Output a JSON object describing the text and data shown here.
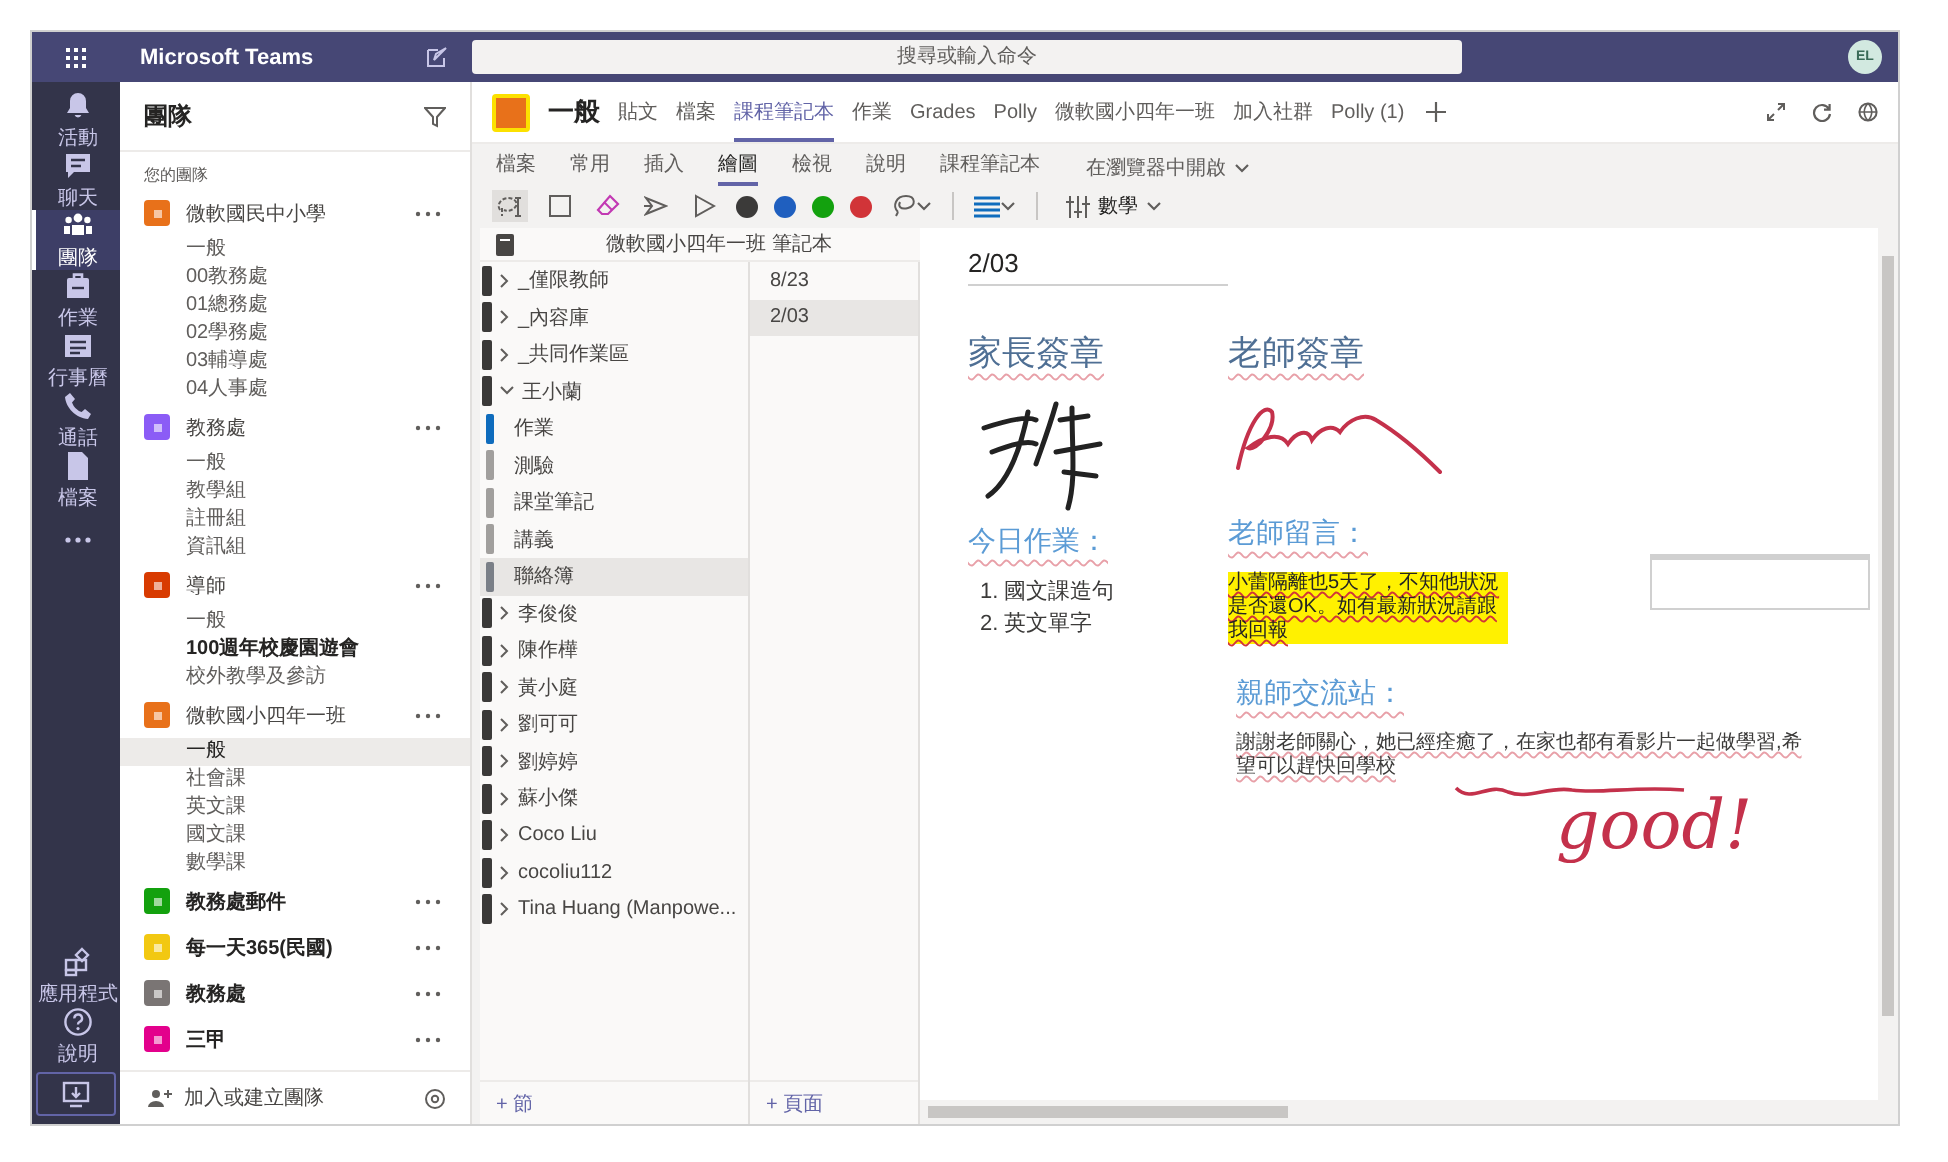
{
  "app": {
    "title": "Microsoft Teams",
    "search": {
      "placeholder": "搜尋或輸入命令"
    },
    "avatar": "EL"
  },
  "rail": [
    {
      "kind": "activity",
      "label": "活動",
      "selected": false
    },
    {
      "kind": "chat",
      "label": "聊天",
      "selected": false
    },
    {
      "kind": "teams",
      "label": "團隊",
      "selected": true
    },
    {
      "kind": "assignments",
      "label": "作業",
      "selected": false
    },
    {
      "kind": "calendar",
      "label": "行事曆",
      "selected": false
    },
    {
      "kind": "calls",
      "label": "通話",
      "selected": false
    },
    {
      "kind": "files",
      "label": "檔案",
      "selected": false
    },
    {
      "kind": "more",
      "selected": false
    }
  ],
  "rail_bottom": [
    {
      "kind": "apps",
      "label": "應用程式"
    },
    {
      "kind": "help",
      "label": "說明"
    },
    {
      "kind": "download"
    }
  ],
  "teams_panel": {
    "title": "團隊",
    "section_label": "您的團隊",
    "join": "加入或建立團隊",
    "teams": [
      {
        "name": "微軟國民中小學",
        "color": "#e8711a",
        "bold": false,
        "channels": [
          {
            "name": "一般",
            "selected": false,
            "bold": false
          },
          {
            "name": "00教務處",
            "selected": false,
            "bold": false
          },
          {
            "name": "01總務處",
            "selected": false,
            "bold": false
          },
          {
            "name": "02學務處",
            "selected": false,
            "bold": false
          },
          {
            "name": "03輔導處",
            "selected": false,
            "bold": false
          },
          {
            "name": "04人事處",
            "selected": false,
            "bold": false
          }
        ]
      },
      {
        "name": "教務處",
        "color": "#8b5cf6",
        "bold": false,
        "channels": [
          {
            "name": "一般",
            "selected": false,
            "bold": false
          },
          {
            "name": "教學組",
            "selected": false,
            "bold": false
          },
          {
            "name": "註冊組",
            "selected": false,
            "bold": false
          },
          {
            "name": "資訊組",
            "selected": false,
            "bold": false
          }
        ]
      },
      {
        "name": "導師",
        "color": "#d83b01",
        "bold": false,
        "channels": [
          {
            "name": "一般",
            "selected": false,
            "bold": false
          },
          {
            "name": "100週年校慶園遊會",
            "selected": false,
            "bold": true
          },
          {
            "name": "校外教學及參訪",
            "selected": false,
            "bold": false
          }
        ]
      },
      {
        "name": "微軟國小四年一班",
        "color": "#e8711a",
        "bold": false,
        "channels": [
          {
            "name": "一般",
            "selected": true,
            "bold": false
          },
          {
            "name": "社會課",
            "selected": false,
            "bold": false
          },
          {
            "name": "英文課",
            "selected": false,
            "bold": false
          },
          {
            "name": "國文課",
            "selected": false,
            "bold": false
          },
          {
            "name": "數學課",
            "selected": false,
            "bold": false
          }
        ]
      },
      {
        "name": "教務處郵件",
        "color": "#13a10e",
        "bold": true
      },
      {
        "name": "每一天365(民國)",
        "color": "#f2c811",
        "bold": true
      },
      {
        "name": "教務處",
        "color": "#7a7574",
        "bold": true
      },
      {
        "name": "三甲",
        "color": "#e3008c",
        "bold": true
      }
    ]
  },
  "channel": {
    "name": "一般",
    "tabs": [
      {
        "label": "貼文",
        "selected": false
      },
      {
        "label": "檔案",
        "selected": false
      },
      {
        "label": "課程筆記本",
        "selected": true
      },
      {
        "label": "作業",
        "selected": false
      },
      {
        "label": "Grades",
        "selected": false
      },
      {
        "label": "Polly",
        "selected": false
      },
      {
        "label": "微軟國小四年一班",
        "selected": false
      },
      {
        "label": "加入社群",
        "selected": false
      },
      {
        "label": "Polly (1)",
        "selected": false
      }
    ]
  },
  "ribbon": {
    "tabs": [
      {
        "label": "檔案",
        "selected": false
      },
      {
        "label": "常用",
        "selected": false
      },
      {
        "label": "插入",
        "selected": false
      },
      {
        "label": "繪圖",
        "selected": true
      },
      {
        "label": "檢視",
        "selected": false
      },
      {
        "label": "說明",
        "selected": false
      },
      {
        "label": "課程筆記本",
        "selected": false
      }
    ],
    "open_in_browser": "在瀏覽器中開啟"
  },
  "toolbar": {
    "pens": [
      {
        "color": "#3b3a39"
      },
      {
        "color": "#1f5fbf"
      },
      {
        "color": "#13a10e"
      },
      {
        "color": "#d13438"
      }
    ],
    "math": "數學"
  },
  "notebook": {
    "title": "微軟國小四年一班 筆記本",
    "add_section": "+ 節",
    "add_page": "+ 頁面",
    "sections": [
      {
        "name": "_僅限教師",
        "expanded": false
      },
      {
        "name": "_內容庫",
        "expanded": false
      },
      {
        "name": "_共同作業區",
        "expanded": false
      },
      {
        "name": "王小蘭",
        "expanded": true,
        "children": [
          {
            "name": "作業",
            "color": "#0f6cbd",
            "selected": false
          },
          {
            "name": "測驗",
            "color": "#a19f9d",
            "selected": false
          },
          {
            "name": "課堂筆記",
            "color": "#a19f9d",
            "selected": false
          },
          {
            "name": "講義",
            "color": "#a19f9d",
            "selected": false
          },
          {
            "name": "聯絡簿",
            "color": "#7a7f87",
            "selected": true
          }
        ]
      },
      {
        "name": "李俊俊",
        "expanded": false
      },
      {
        "name": "陳作樺",
        "expanded": false
      },
      {
        "name": "黃小庭",
        "expanded": false
      },
      {
        "name": "劉可可",
        "expanded": false
      },
      {
        "name": "劉婷婷",
        "expanded": false
      },
      {
        "name": "蘇小傑",
        "expanded": false
      },
      {
        "name": "Coco Liu",
        "expanded": false
      },
      {
        "name": "cocoliu112",
        "expanded": false
      },
      {
        "name": "Tina Huang (Manpowe...",
        "expanded": false
      }
    ],
    "pages": [
      {
        "title": "8/23",
        "selected": false
      },
      {
        "title": "2/03",
        "selected": true
      }
    ]
  },
  "page": {
    "title": "2/03",
    "parent_sign": "家長簽章",
    "teacher_sign": "老師簽章",
    "homework": {
      "heading": "今日作業：",
      "items": [
        "1.  國文課造句",
        "2.  英文單字"
      ]
    },
    "teacher_note": {
      "heading": "老師留言：",
      "text": "小蕾隔離也5天了，不知他狀況是否還OK。如有最新狀況請跟我回報"
    },
    "exchange": {
      "heading": "親師交流站：",
      "text": "謝謝老師關心，她已經痊癒了，在家也都有看影片一起做學習,希望可以趕快回學校"
    },
    "ink_note": "good!"
  }
}
